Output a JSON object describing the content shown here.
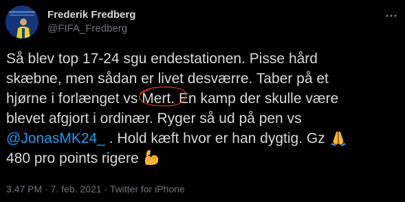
{
  "author": {
    "display_name": "Frederik Fredberg",
    "handle": "@FIFA_Fredberg"
  },
  "tweet": {
    "line1": "Så blev top 17-24 sgu endestationen. Pisse hård",
    "line2": "skæbne, men sådan er livet desværre. Taber på et",
    "line3_before": "hjørne i forlænget vs ",
    "line3_circled": "Mert.",
    "line3_after": " En kamp der skulle være",
    "line4": "blevet afgjort i ordinær. Ryger så ud på pen vs",
    "line5_mention": "@JonasMK24_",
    "line5_after": " . Hold kæft hvor er han dygtig. Gz ",
    "line6": "480 pro points rigere ",
    "emoji_1": "folded-hands",
    "emoji_2": "flexed-biceps"
  },
  "meta": {
    "time": "3.47 PM",
    "separator": " · ",
    "date": "7. feb. 2021",
    "source": "Twitter for iPhone"
  },
  "colors": {
    "background": "#000000",
    "text": "#d9d9d9",
    "muted": "#6e767d",
    "link": "#1d9bf0",
    "annotation": "#e0302a"
  }
}
